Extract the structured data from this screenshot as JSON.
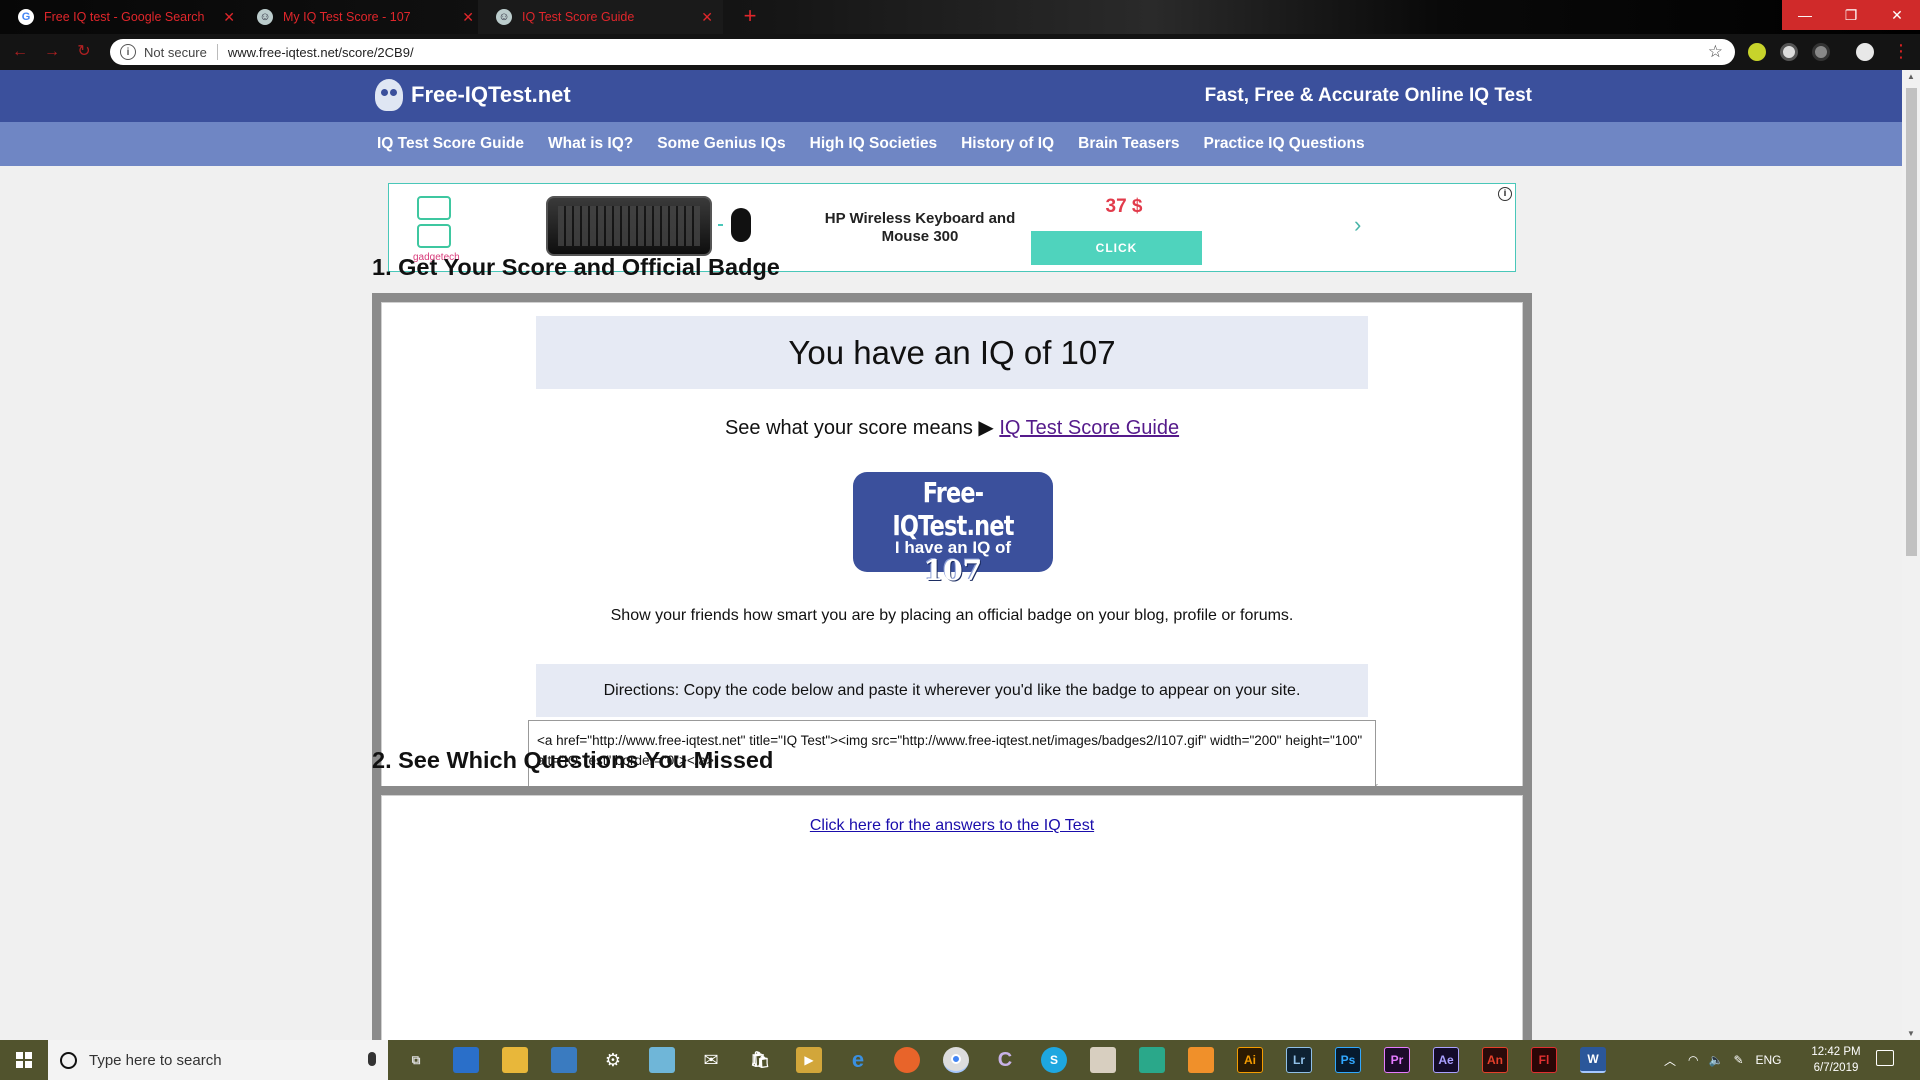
{
  "browser": {
    "tabs": [
      {
        "title": "Free IQ test - Google Search",
        "icon": "google-favicon"
      },
      {
        "title": "My IQ Test Score - 107",
        "icon": "site-favicon"
      },
      {
        "title": "IQ Test Score Guide",
        "icon": "site-favicon"
      }
    ],
    "security_label": "Not secure",
    "url": "www.free-iqtest.net/score/2CB9/"
  },
  "site": {
    "logo": "Free-IQTest.net",
    "tagline": "Fast, Free & Accurate Online IQ Test",
    "nav": [
      "IQ Test Score Guide",
      "What is IQ?",
      "Some Genius IQs",
      "High IQ Societies",
      "History of IQ",
      "Brain Teasers",
      "Practice IQ Questions"
    ]
  },
  "ad": {
    "brand": "gadgetech",
    "title": "HP Wireless Keyboard and Mouse 300",
    "price": "37 $",
    "cta": "CLICK"
  },
  "section1": {
    "heading": "1. Get Your Score and Official Badge",
    "score_text": "You have an IQ of 107",
    "meaning_prefix": "See what your score means ▶ ",
    "meaning_link": "IQ Test Score Guide",
    "badge": {
      "brand": "Free-IQTest.net",
      "line": "I have an IQ of",
      "score": "107"
    },
    "friends_text": "Show your friends how smart you are by placing an official badge on your blog, profile or forums.",
    "directions": "Directions: Copy the code below and paste it wherever you'd like the badge to appear on your site.",
    "code": "<a href=\"http://www.free-iqtest.net\" title=\"IQ Test\"><img src=\"http://www.free-iqtest.net/images/badges2/I107.gif\" width=\"200\" height=\"100\" alt=\"IQ Test\" border=\"0\"></a>"
  },
  "section2": {
    "heading": "2. See Which Questions You Missed",
    "answers_link": "Click here for the answers to the IQ Test"
  },
  "taskbar": {
    "search_placeholder": "Type here to search",
    "language": "ENG",
    "time": "12:42 PM",
    "date": "6/7/2019"
  },
  "colors": {
    "header_blue": "#3b509c",
    "nav_blue": "#6f86c4",
    "ad_teal": "#4fd3bd",
    "tab_red": "#e0262b"
  }
}
